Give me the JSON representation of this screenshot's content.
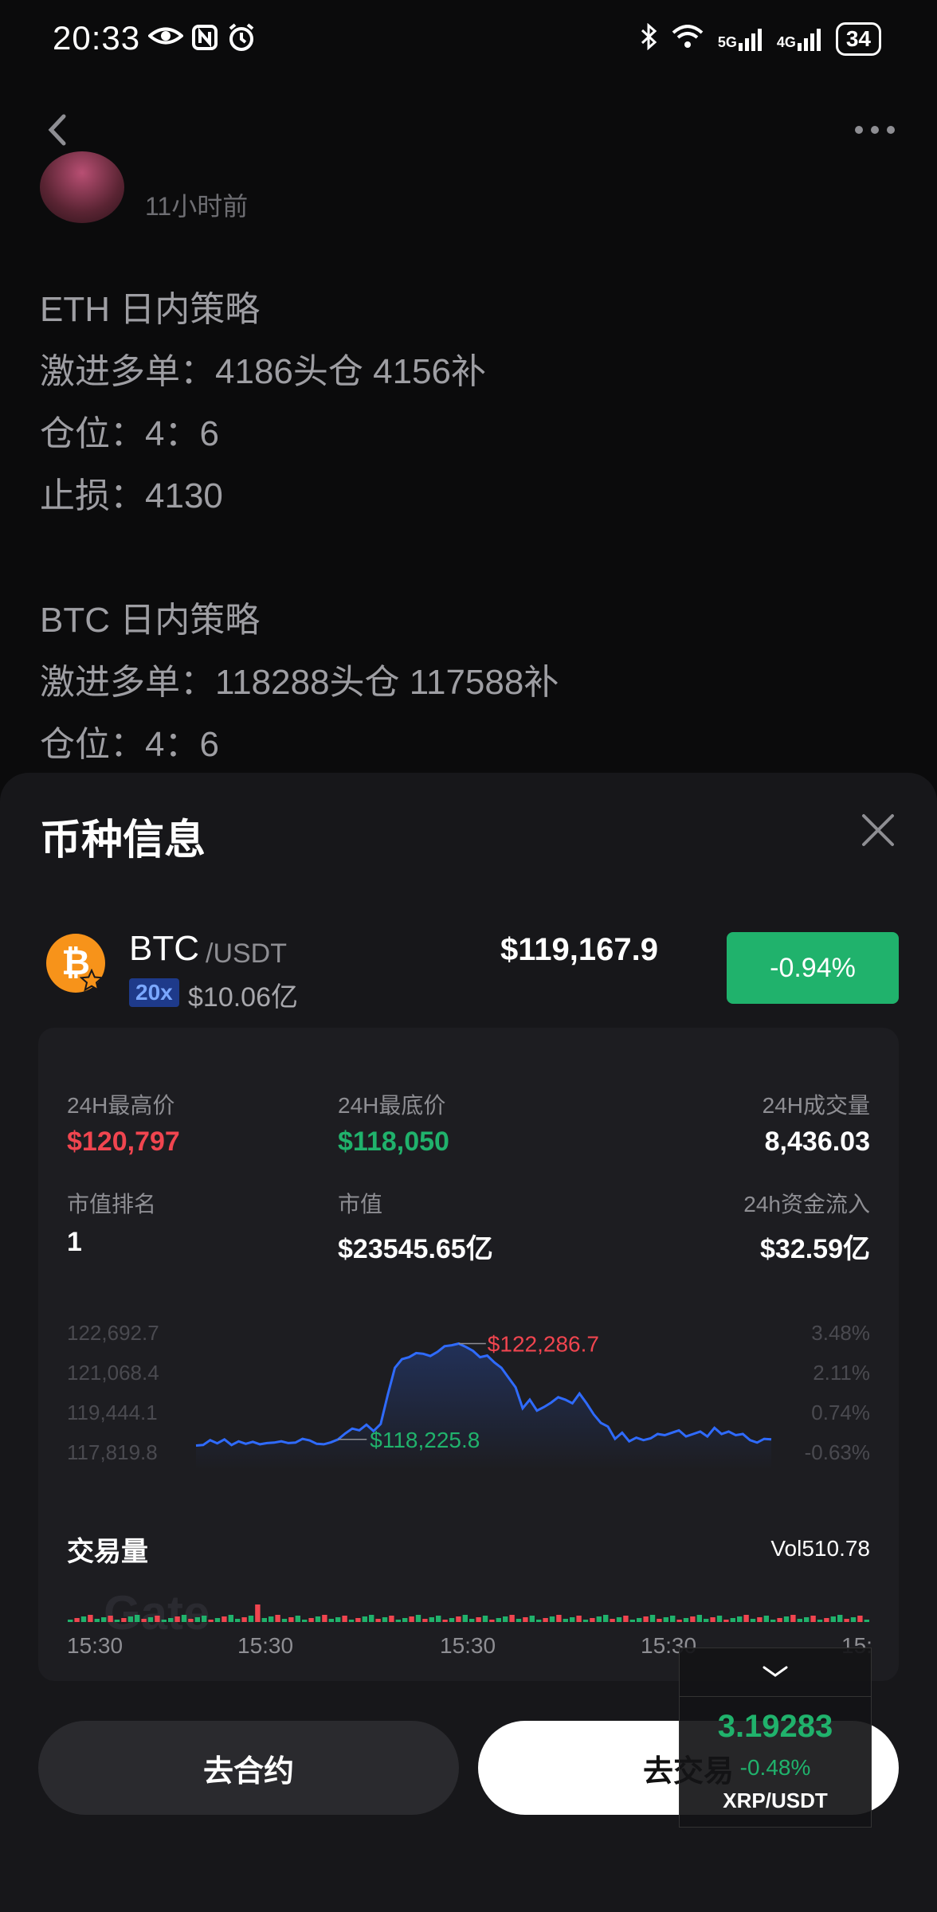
{
  "status_bar": {
    "time": "20:33",
    "network_5g": "5G",
    "network_4g": "4G",
    "battery": "34"
  },
  "post": {
    "time_ago": "11小时前",
    "lines": [
      "ETH 日内策略",
      "激进多单：4186头仓 4156补",
      "仓位：4：6",
      "止损：4130",
      "",
      "BTC 日内策略",
      "激进多单：118288头仓 117588补",
      "仓位：4：6"
    ]
  },
  "sheet": {
    "title": "币种信息",
    "coin": {
      "symbol": "BTC",
      "quote": "/USDT",
      "leverage": "20x",
      "market_cap_short": "$10.06亿",
      "price": "$119,167.9",
      "change": "-0.94%"
    },
    "stats": {
      "high_label": "24H最高价",
      "high_value": "$120,797",
      "low_label": "24H最底价",
      "low_value": "$118,050",
      "volume_label": "24H成交量",
      "volume_value": "8,436.03",
      "rank_label": "市值排名",
      "rank_value": "1",
      "mcap_label": "市值",
      "mcap_value": "$23545.65亿",
      "inflow_label": "24h资金流入",
      "inflow_value": "$32.59亿"
    },
    "volume": {
      "title": "交易量",
      "value": "Vol510.78",
      "watermark": "Gate"
    },
    "time_labels": [
      "15:30",
      "15:30",
      "15:30",
      "15:30",
      "15:"
    ],
    "buttons": {
      "contract": "去合约",
      "trade": "去交易"
    },
    "ticker": {
      "price": "3.19283",
      "change": "-0.48%",
      "pair": "XRP/USDT"
    }
  },
  "colors": {
    "up": "#20b26c",
    "down": "#f0454f",
    "line": "#2f6bff"
  },
  "chart_data": {
    "type": "line",
    "title": "",
    "y_ticks": [
      "122,692.7",
      "121,068.4",
      "119,444.1",
      "117,819.8"
    ],
    "y2_ticks": [
      "3.48%",
      "2.11%",
      "0.74%",
      "-0.63%"
    ],
    "ylim": [
      117819.8,
      122692.7
    ],
    "annotations": [
      {
        "label": "$122,286.7",
        "value": 122286.7,
        "kind": "high"
      },
      {
        "label": "$118,225.8",
        "value": 118225.8,
        "kind": "low"
      }
    ],
    "series": [
      {
        "values": [
          118130,
          118150,
          118350,
          118220,
          118380,
          118150,
          118300,
          118200,
          118280,
          118180,
          118230,
          118250,
          118300,
          118230,
          118250,
          118400,
          118340,
          118200,
          118180,
          118260,
          118380,
          118620,
          118820,
          118750,
          118980,
          118720,
          119010,
          120200,
          121300,
          121650,
          121730,
          121900,
          121870,
          121780,
          121950,
          122180,
          122220,
          122287,
          122150,
          121990,
          121730,
          121800,
          121520,
          121300,
          120900,
          120500,
          119650,
          120000,
          119550,
          119700,
          119880,
          120100,
          120000,
          119850,
          120250,
          119850,
          119400,
          119050,
          118900,
          118400,
          118650,
          118300,
          118450,
          118350,
          118420,
          118600,
          118550,
          118650,
          118750,
          118500,
          118600,
          118700,
          118500,
          118850,
          118600,
          118700,
          118550,
          118600,
          118350,
          118250,
          118400,
          118380
        ]
      }
    ]
  }
}
